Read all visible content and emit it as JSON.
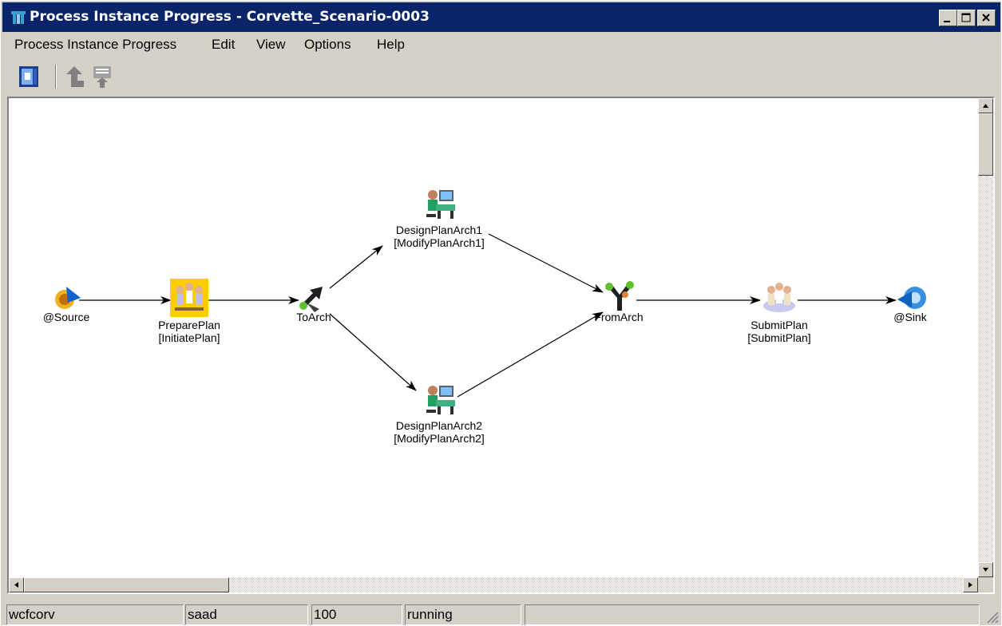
{
  "window": {
    "title": "Process Instance Progress - Corvette_Scenario-0003",
    "controls": [
      "minimize-icon",
      "maximize-icon",
      "close-icon"
    ]
  },
  "menu": {
    "items": [
      "Process Instance Progress",
      "Edit",
      "View",
      "Options",
      "Help"
    ]
  },
  "toolbar": {
    "buttons": [
      "exit-icon",
      "up-arrow-icon",
      "upload-icon"
    ]
  },
  "diagram": {
    "nodes": [
      {
        "name": "@Source",
        "sub": "",
        "icon": "source-icon"
      },
      {
        "name": "PreparePlan",
        "sub": "[InitiatePlan]",
        "icon": "group-activity-icon"
      },
      {
        "name": "ToArch",
        "sub": "",
        "icon": "split-icon"
      },
      {
        "name": "DesignPlanArch1",
        "sub": "[ModifyPlanArch1]",
        "icon": "user-workstation-icon"
      },
      {
        "name": "DesignPlanArch2",
        "sub": "[ModifyPlanArch2]",
        "icon": "user-workstation-icon"
      },
      {
        "name": "FromArch",
        "sub": "",
        "icon": "join-icon"
      },
      {
        "name": "SubmitPlan",
        "sub": "[SubmitPlan]",
        "icon": "group-activity-icon"
      },
      {
        "name": "@Sink",
        "sub": "",
        "icon": "sink-icon"
      }
    ]
  },
  "status": {
    "panels": [
      "wcfcorv",
      "saad",
      "100",
      "running",
      ""
    ]
  },
  "colors": {
    "titlebar": "#0a246a",
    "face": "#d4d0c8",
    "highlight_node": "#ffcc00"
  }
}
